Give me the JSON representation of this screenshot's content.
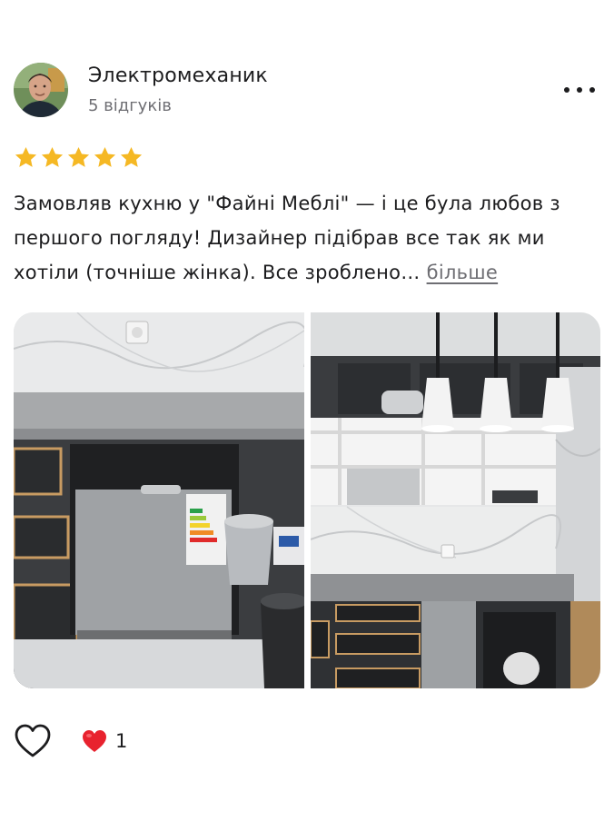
{
  "review": {
    "author_name": "Электромеханик",
    "author_reviews": "5 відгуків",
    "rating": 5,
    "star_color": "#f5b824",
    "text_before_more": "Замовляв кухню у \"Файні Меблі\" — і це була любов з першого погляду! Дизайнер підібрав все так як ми хотіли (точніше жінка). Все зроблено… ",
    "more_label": "більше"
  },
  "photos": [
    {
      "name": "dishwasher-installation-photo"
    },
    {
      "name": "kitchen-shelves-pendant-lamps-photo"
    }
  ],
  "actions": {
    "like_icon": "heart-outline-icon",
    "reaction_icon": "red-heart-icon",
    "reaction_color": "#e8222e",
    "reaction_count": "1"
  }
}
